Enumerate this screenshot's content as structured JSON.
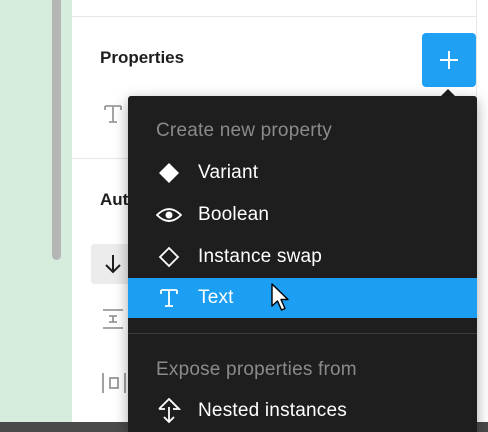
{
  "properties": {
    "title": "Properties",
    "add_button_icon": "plus-icon",
    "text_row_icon": "text-icon"
  },
  "autolayout": {
    "title_partial": "Aut",
    "direction_icon": "arrow-down-icon",
    "spacing_icon": "vertical-spacing-icon",
    "padding_icon": "horizontal-padding-icon"
  },
  "menu": {
    "header_create": "Create new property",
    "items": [
      {
        "label": "Variant",
        "icon": "diamond-filled-icon"
      },
      {
        "label": "Boolean",
        "icon": "eye-icon"
      },
      {
        "label": "Instance swap",
        "icon": "diamond-outline-icon"
      },
      {
        "label": "Text",
        "icon": "text-icon",
        "selected": true
      }
    ],
    "header_expose": "Expose properties from",
    "expose_items": [
      {
        "label": "Nested instances",
        "icon": "nested-instances-icon"
      }
    ]
  },
  "colors": {
    "accent": "#1fa0f2",
    "menu_bg": "#1e1e1e",
    "selected_bg": "#1c9ff2",
    "canvas": "#d6ecdd"
  }
}
